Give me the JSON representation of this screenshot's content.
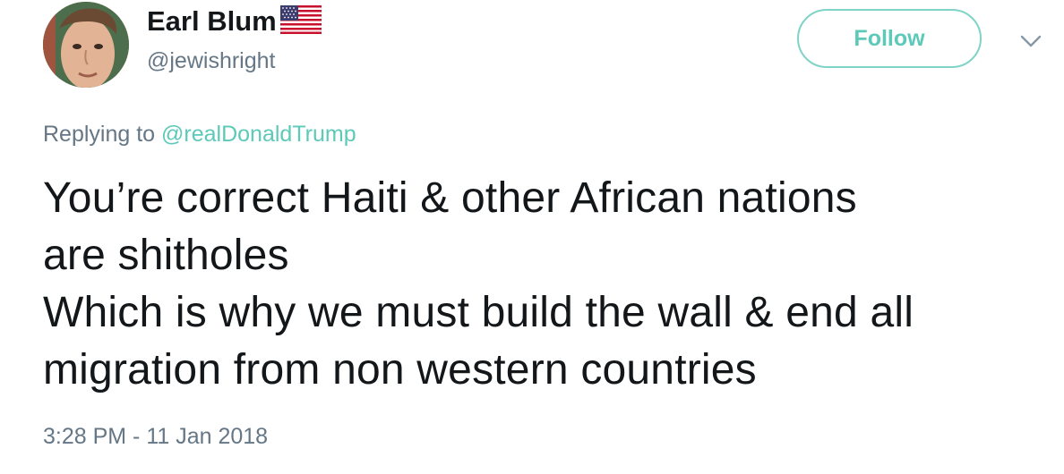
{
  "user": {
    "display_name": "Earl Blum",
    "handle": "@jewishright",
    "flag_icon": "us-flag-icon"
  },
  "actions": {
    "follow_label": "Follow",
    "menu_icon": "chevron-down-icon"
  },
  "reply": {
    "prefix": "Replying to",
    "mention": "@realDonaldTrump"
  },
  "tweet": {
    "lines": [
      "You’re correct Haiti & other African nations",
      "are shitholes",
      "Which is why we must build the wall & end all",
      "migration from non western countries"
    ]
  },
  "meta": {
    "timestamp": "3:28 PM - 11 Jan 2018"
  },
  "colors": {
    "text": "#14171a",
    "secondary": "#657786",
    "accent": "#5cc9b9",
    "follow_border": "#7fd3c7"
  }
}
